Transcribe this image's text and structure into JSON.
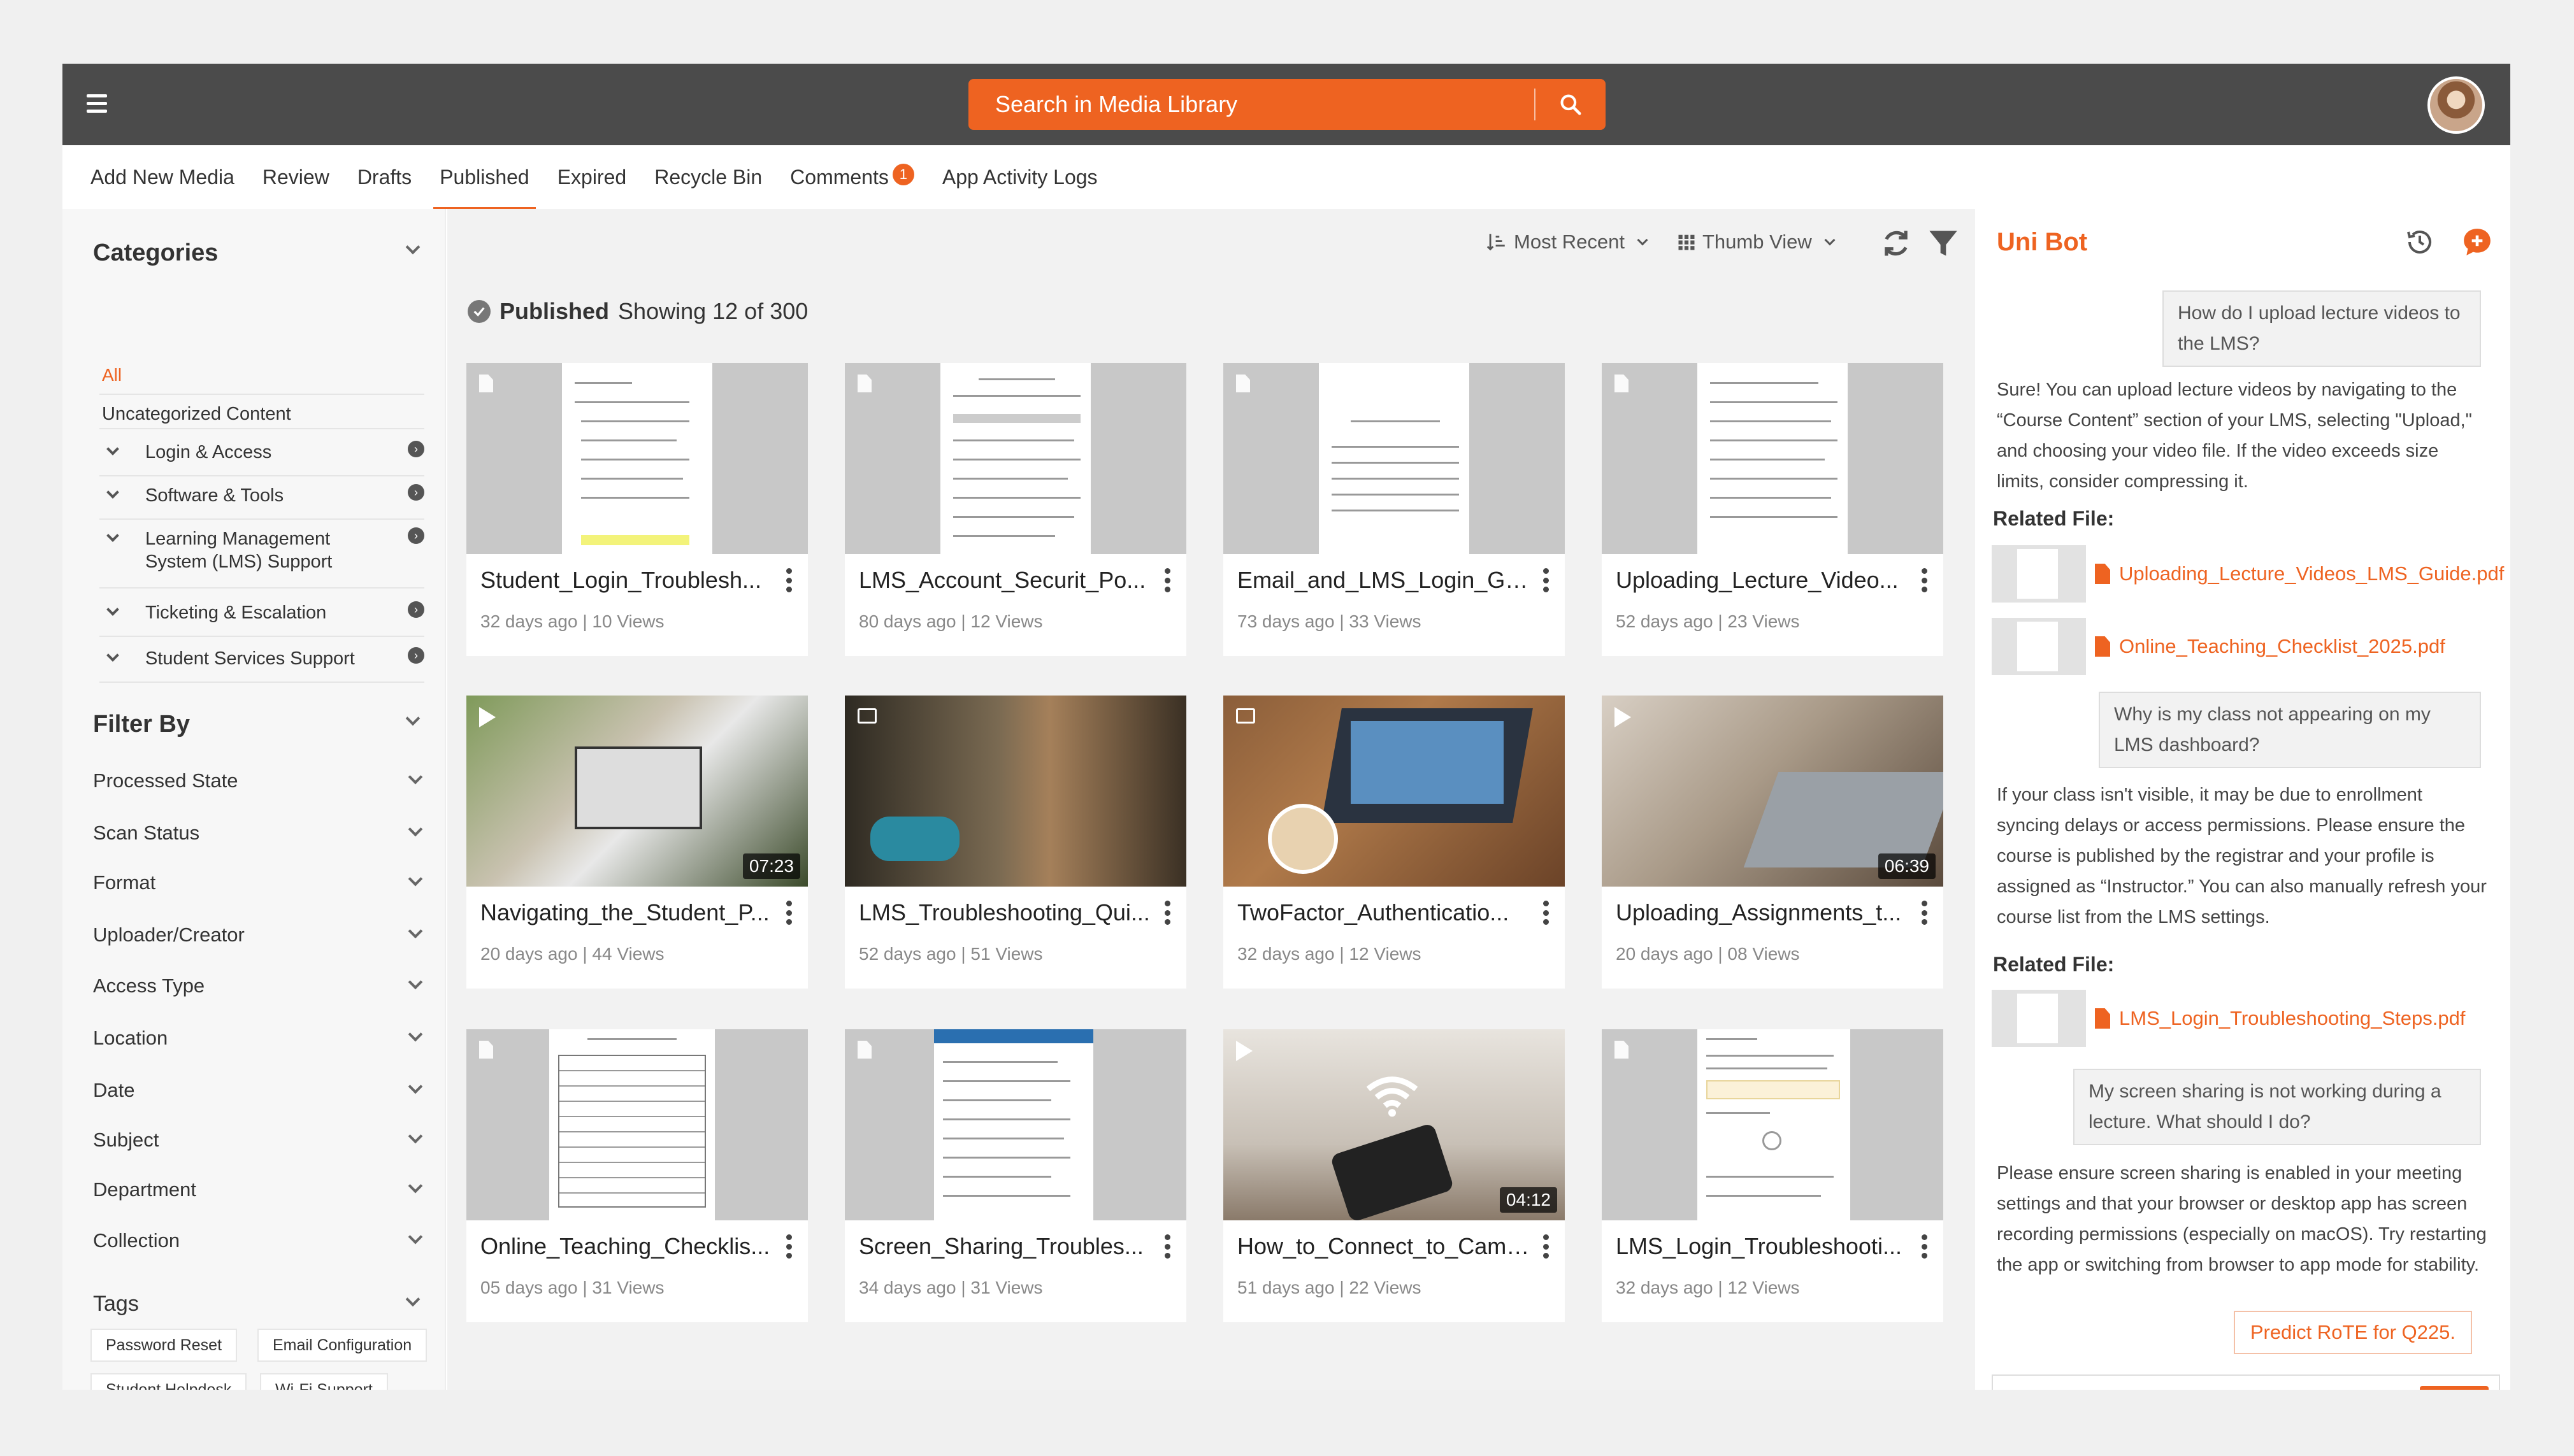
{
  "search": {
    "placeholder": "Search in Media Library"
  },
  "tabs": [
    {
      "label": "Add New Media"
    },
    {
      "label": "Review"
    },
    {
      "label": "Drafts"
    },
    {
      "label": "Published"
    },
    {
      "label": "Expired"
    },
    {
      "label": "Recycle Bin"
    },
    {
      "label": "Comments",
      "badge": "1"
    },
    {
      "label": "App Activity Logs"
    }
  ],
  "sidebar": {
    "categories_title": "Categories",
    "all_label": "All",
    "uncategorized": "Uncategorized Content",
    "categories": [
      {
        "label": "Login & Access"
      },
      {
        "label": "Software & Tools"
      },
      {
        "label": "Learning Management",
        "label2": "System (LMS) Support"
      },
      {
        "label": "Ticketing & Escalation"
      },
      {
        "label": "Student Services Support"
      }
    ],
    "filter_title": "Filter By",
    "filters": [
      "Processed State",
      "Scan Status",
      "Format",
      "Uploader/Creator",
      "Access Type",
      "Location",
      "Date",
      "Subject",
      "Department",
      "Collection"
    ],
    "tags_title": "Tags",
    "tags": [
      "Password Reset",
      "Email Configuration",
      "Student Helpdesk",
      "Wi-Fi Support"
    ]
  },
  "toolbar": {
    "sort": "Most Recent",
    "view": "Thumb View"
  },
  "status": {
    "label": "Published",
    "count_text": "Showing 12 of 300"
  },
  "cards": [
    {
      "title": "Student_Login_Troublesh...",
      "meta": "32 days ago | 10 Views",
      "kind": "doc"
    },
    {
      "title": "LMS_Account_Securit_Po...",
      "meta": "80 days ago | 12 Views",
      "kind": "doc"
    },
    {
      "title": "Email_and_LMS_Login_Gu...",
      "meta": "73 days ago | 33 Views",
      "kind": "doc"
    },
    {
      "title": "Uploading_Lecture_Video...",
      "meta": "52 days ago | 23 Views",
      "kind": "doc"
    },
    {
      "title": "Navigating_the_Student_P...",
      "meta": "20 days ago | 44 Views",
      "kind": "video",
      "duration": "07:23"
    },
    {
      "title": "LMS_Troubleshooting_Qui...",
      "meta": "52 days ago | 51 Views",
      "kind": "image"
    },
    {
      "title": "TwoFactor_Authenticatio...",
      "meta": "32 days ago | 12 Views",
      "kind": "image"
    },
    {
      "title": "Uploading_Assignments_t...",
      "meta": "20 days ago | 08 Views",
      "kind": "video",
      "duration": "06:39"
    },
    {
      "title": "Online_Teaching_Checklis...",
      "meta": "05 days ago | 31 Views",
      "kind": "doc"
    },
    {
      "title": "Screen_Sharing_Troubles...",
      "meta": "34 days ago | 31 Views",
      "kind": "doc"
    },
    {
      "title": "How_to_Connect_to_Camp...",
      "meta": "51 days ago | 22 Views",
      "kind": "video",
      "duration": "04:12"
    },
    {
      "title": "LMS_Login_Troubleshooti...",
      "meta": "32 days ago | 12 Views",
      "kind": "doc"
    }
  ],
  "chat": {
    "title": "Uni Bot",
    "q1": "How do I upload lecture videos to the LMS?",
    "a1": "Sure! You can upload lecture videos by navigating to the “Course Content” section of your LMS, selecting \"Upload,\" and choosing your video file. If the video exceeds size limits, consider compressing it.",
    "related_label": "Related File:",
    "file1": "Uploading_Lecture_Videos_LMS_Guide.pdf",
    "file2": "Online_Teaching_Checklist_2025.pdf",
    "q2": "Why is my class not appearing on my LMS dashboard?",
    "a2": "If your class isn't visible, it may be due to enrollment syncing delays or access permissions. Please ensure the course is published by the registrar and your profile is assigned as “Instructor.” You can also manually refresh your course list from the LMS settings.",
    "file3": "LMS_Login_Troubleshooting_Steps.pdf",
    "q3": "My screen sharing is not working during a lecture. What should I do?",
    "a3": "Please ensure screen sharing is enabled in your meeting settings and that your browser or desktop app has screen recording permissions (especially on macOS). Try restarting the app or switching from browser to app mode for stability.",
    "suggestion": "Predict RoTE for Q225.",
    "input_placeholder": ""
  },
  "colors": {
    "accent": "#ee6321",
    "topbar": "#4b4b4b"
  },
  "icons": [
    "hamburger-icon",
    "search-icon",
    "history-icon",
    "chat-add-icon",
    "close-icon",
    "sort-icon",
    "grid-icon",
    "refresh-icon",
    "filter-icon",
    "check-circle-icon",
    "document-icon",
    "play-icon",
    "image-icon",
    "pdf-icon",
    "send-icon"
  ]
}
